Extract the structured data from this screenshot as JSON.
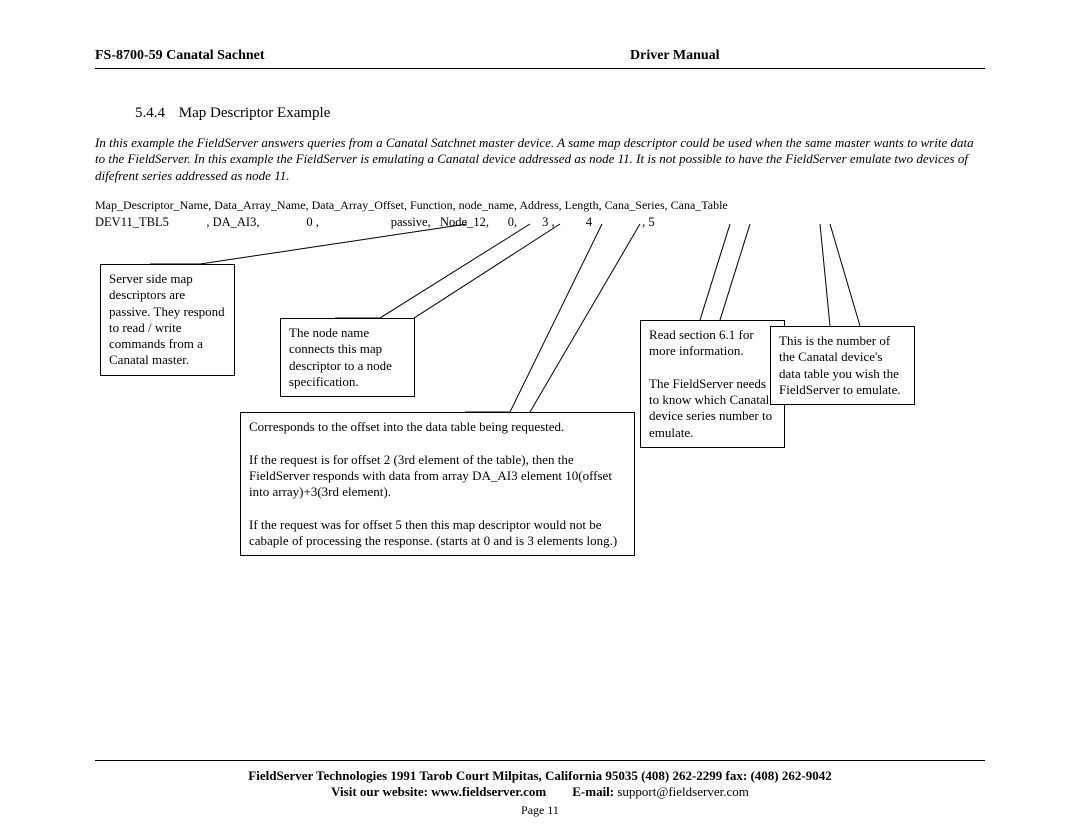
{
  "header": {
    "left": "FS-8700-59 Canatal Sachnet",
    "right": "Driver Manual"
  },
  "section": {
    "number": "5.4.4",
    "title": "Map Descriptor Example"
  },
  "intro": "In this example the FieldServer answers queries from a Canatal Satchnet master device. A same map descriptor could be used when the same master wants to write data to the FieldServer. In this example the FieldServer is emulating a Canatal device addressed as node 11. It is not possible to have the FieldServer emulate two devices of difefrent series addressed as node 11.",
  "table": {
    "headers": "Map_Descriptor_Name, Data_Array_Name, Data_Array_Offset, Function, node_name, Address, Length, Cana_Series, Cana_Table",
    "row": "DEV11_TBL5            , DA_AI3,               0 ,                       passive,   Node_12,      0,        3 ,          4                , 5"
  },
  "callouts": {
    "c1": "Server side map descriptors are passive. They respond to read / write commands from a Canatal master.",
    "c2": "The node name connects this map descriptor to a node specification.",
    "c3": "Corresponds to the offset into the data table being requested.\n\nIf the request is for offset 2 (3rd element of the table), then the FieldServer responds with data from array DA_AI3 element 10(offset into array)+3(3rd element).\n\nIf the request was for offset 5 then this map descriptor would not be cabaple of processing the response. (starts at 0 and is 3 elements long.)",
    "c4": "Read section 6.1 for more information.\n\nThe FieldServer needs to know which Canatal device series number to emulate.",
    "c5": "This is the number of the Canatal device's data table you wish the FieldServer to emulate."
  },
  "footer": {
    "line1": "FieldServer Technologies 1991 Tarob Court Milpitas, California 95035 (408) 262-2299  fax: (408) 262-9042",
    "visit_label": "Visit our website: ",
    "visit_value": "www.fieldserver.com",
    "email_label": "E-mail:",
    "email_value": " support@fieldserver.com",
    "page": "Page 11"
  }
}
